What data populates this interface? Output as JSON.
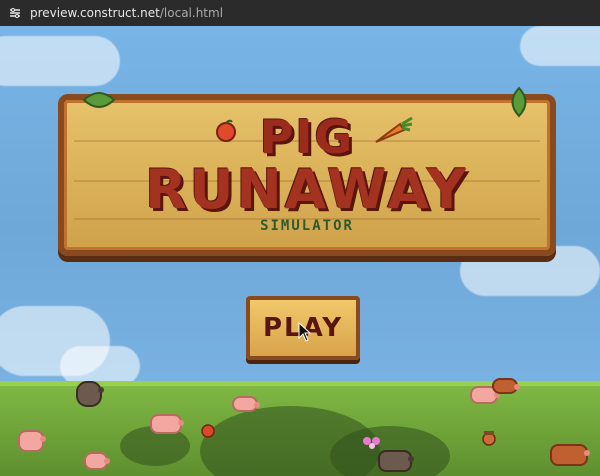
{
  "browser": {
    "url_prefix": "preview.construct.net",
    "url_path": "/local.html"
  },
  "game": {
    "title_line_1": "PIG",
    "title_line_2": "RUNAWAY",
    "subtitle": "SIMULATOR",
    "play_label": "PLAY"
  },
  "colors": {
    "sky": "#6fa8dc",
    "sign_wood": "#e6c26a",
    "title_red": "#a33220",
    "subtitle_green": "#2f5a2f",
    "grass": "#7fb844"
  }
}
